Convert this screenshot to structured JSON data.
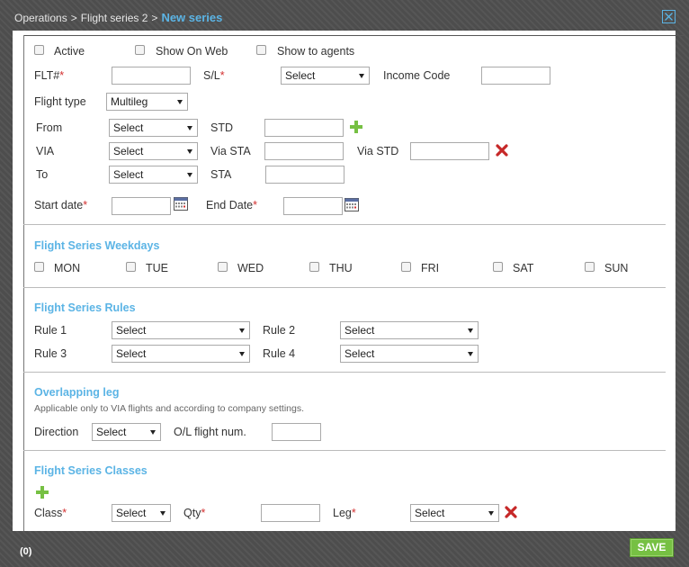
{
  "breadcrumb": {
    "items": [
      "Operations",
      "Flight series 2"
    ],
    "separator": ">",
    "current": "New series"
  },
  "flags": {
    "active": "Active",
    "show_on_web": "Show On Web",
    "show_to_agents": "Show to agents"
  },
  "fields": {
    "flt": "FLT#",
    "sl": "S/L",
    "income_code": "Income Code",
    "flight_type": "Flight type",
    "from": "From",
    "std": "STD",
    "via": "VIA",
    "via_sta": "Via STA",
    "via_std": "Via STD",
    "to": "To",
    "sta": "STA",
    "start_date": "Start date",
    "end_date": "End Date"
  },
  "required_mark": "*",
  "select_placeholder": "Select",
  "flight_type_value": "Multileg",
  "weekdays": {
    "title": "Flight Series Weekdays",
    "days": [
      "MON",
      "TUE",
      "WED",
      "THU",
      "FRI",
      "SAT",
      "SUN"
    ]
  },
  "rules": {
    "title": "Flight Series Rules",
    "rule1": "Rule 1",
    "rule2": "Rule 2",
    "rule3": "Rule 3",
    "rule4": "Rule 4"
  },
  "overlap": {
    "title": "Overlapping leg",
    "note": "Applicable only to VIA flights and according to company settings.",
    "direction": "Direction",
    "ol_flight": "O/L flight num."
  },
  "classes": {
    "title": "Flight Series Classes",
    "class": "Class",
    "qty": "Qty",
    "leg": "Leg"
  },
  "footer": {
    "count": "(0)",
    "save": "SAVE"
  },
  "colors": {
    "accent": "#5bb4e5",
    "required": "#d32f2f",
    "add": "#76c043",
    "delete": "#c62828"
  }
}
